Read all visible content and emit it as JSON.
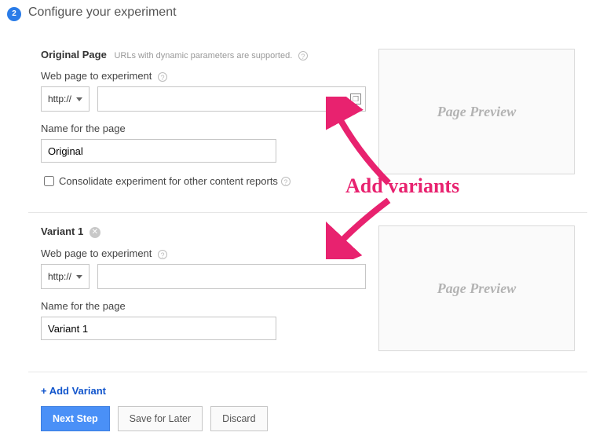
{
  "step_number": "2",
  "title": "Configure your experiment",
  "original": {
    "heading": "Original Page",
    "hint": "URLs with dynamic parameters are supported.",
    "url_label": "Web page to experiment",
    "protocol": "http://",
    "url_value": "",
    "name_label": "Name for the page",
    "name_value": "Original",
    "consolidate_label": "Consolidate experiment for other content reports",
    "preview_label": "Page Preview"
  },
  "variant1": {
    "heading": "Variant 1",
    "url_label": "Web page to experiment",
    "protocol": "http://",
    "url_value": "",
    "name_label": "Name for the page",
    "name_value": "Variant 1",
    "preview_label": "Page Preview"
  },
  "add_variant_label": "+ Add Variant",
  "buttons": {
    "next": "Next Step",
    "save": "Save for Later",
    "discard": "Discard"
  },
  "annotation": "Add variants"
}
